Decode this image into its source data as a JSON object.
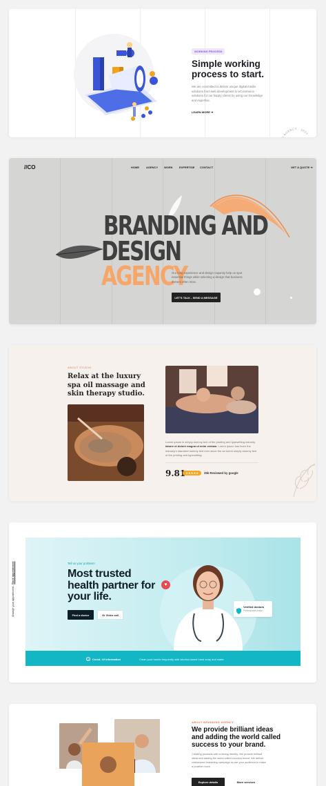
{
  "card1": {
    "eyebrow": "WORKING PROCESS",
    "title": "Simple working process to start.",
    "description": "We are committed to deliver unique digital media solutions from web development to eCommerce solutions for our happy clients by using our knowledge and expertise.",
    "link": "LEARN MORE ➔",
    "rotating_badge": "SEO AGENCY · 2021 · EXPERT"
  },
  "card2": {
    "logo": "//CO",
    "nav": [
      "HOME",
      "AGENCY",
      "WORK",
      "EXPERTISE",
      "CONTACT"
    ],
    "quote_label": "GET A QUOTE ➔",
    "headline_line1": "BRANDING AND",
    "headline_line2_plain": "DESIGN ",
    "headline_line2_accent": "AGENCY",
    "subtitle": "Our long experience and design capacity help us spot essential things while selecting a design that business owners often miss.",
    "cta": "LET'S TALK - SEND A MESSAGE",
    "colors": {
      "background": "#d5d5d3",
      "accent": "#f7a66a"
    }
  },
  "card3": {
    "label": "ABOUT STUDIO",
    "title": "Relax at the luxury spa oil massage and skin therapy studio.",
    "description_start": "Lorem ipsum is simply dummy text of the printing and typesetting industry. ",
    "description_bold": "labore et dolore magna ut enim veniam.",
    "description_end": " Lorem ipsum has been the industry's standard dummy text ever since the an lorem simply dummy text of the printing and typesetting.",
    "score": "9.81",
    "stars": "★★★★★",
    "review": "25k Reviewed by google"
  },
  "card4": {
    "side_text_plain": "Arrange your appointment - ",
    "side_text_link": "Book appointment",
    "eyebrow": "Tell us your problem!",
    "title": "Most trusted health partner for your life.",
    "btn_primary": "Find a doctor",
    "btn_secondary": "Or Video call",
    "verified_title": "Verified doctors",
    "verified_sub": "Professional doctor",
    "covid": "Covid- 19 information",
    "hygiene": "Clean your hands frequently with alcohol-based hand soap and water.",
    "colors": {
      "teal": "#13b6c4",
      "dark": "#0d1e28",
      "heart": "#e84a4f"
    }
  },
  "card5": {
    "eyebrow": "ABOUT BRANDING AGENCY",
    "title": "We provide brilliant ideas and adding the world called success to your brand.",
    "description": "Creating products with a strong identity. We provide brilliant ideas and adding the world called success brand. We deliver customized marketing campaign to use your audience to make a positive move.",
    "btn_primary": "Explore details",
    "btn_secondary": "More services"
  }
}
